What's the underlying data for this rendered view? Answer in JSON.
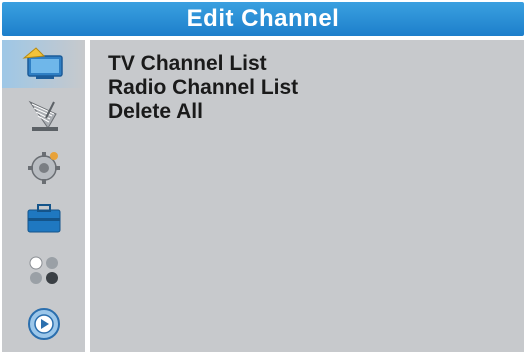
{
  "header": {
    "title": "Edit Channel"
  },
  "sidebar": {
    "items": [
      {
        "icon": "edit-channel-icon",
        "active": true
      },
      {
        "icon": "installation-icon",
        "active": false
      },
      {
        "icon": "system-setup-icon",
        "active": false
      },
      {
        "icon": "tools-icon",
        "active": false
      },
      {
        "icon": "games-icon",
        "active": false
      },
      {
        "icon": "media-icon",
        "active": false
      }
    ]
  },
  "menu": {
    "items": [
      {
        "label": "TV Channel List"
      },
      {
        "label": "Radio Channel List"
      },
      {
        "label": "Delete All"
      }
    ]
  },
  "colors": {
    "title_bar": "#1d7fcb",
    "panel_bg": "#c7c9cc",
    "text": "#1a1a1a"
  }
}
